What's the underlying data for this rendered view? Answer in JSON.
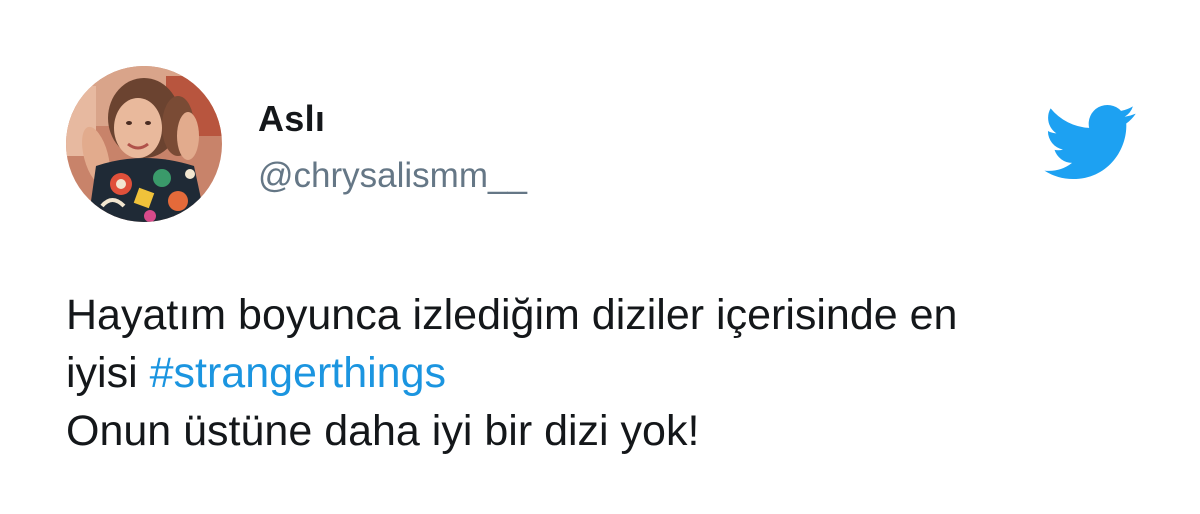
{
  "author": {
    "display_name": "Aslı",
    "handle": "@chrysalismm__",
    "avatar_icon": "profile-photo"
  },
  "brand": {
    "logo_icon": "twitter-bird-icon",
    "color": "#1DA1F2"
  },
  "tweet": {
    "line1": "Hayatım boyunca izlediğim diziler içerisinde en",
    "line2_prefix": "iyisi ",
    "hashtag": "#strangerthings",
    "line3": "Onun üstüne daha iyi bir dizi yok!"
  },
  "colors": {
    "text": "#14171A",
    "secondary": "#657786",
    "link": "#1B95E0"
  }
}
